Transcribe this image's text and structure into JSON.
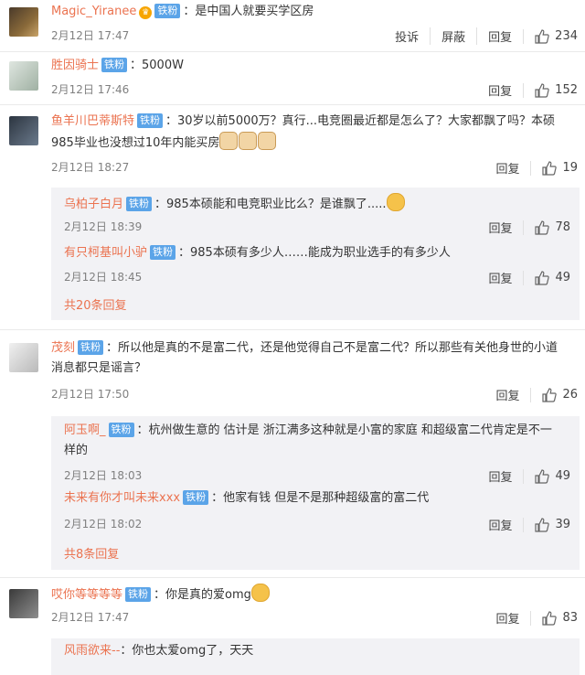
{
  "badge_label": "铁粉",
  "reply_label": "回复",
  "comments": [
    {
      "user": "Magic_Yiranee",
      "text": "：是中国人就要买学区房",
      "time": "2月12日 17:47",
      "complain": "投诉",
      "block": "屏蔽",
      "likes": "234"
    },
    {
      "user": "胜因骑士",
      "text": "：5000W",
      "time": "2月12日 17:46",
      "likes": "152"
    },
    {
      "user": "鱼羊川巴蒂斯特",
      "text": "：30岁以前5000万？真行...电竞圈最近都是怎么了？大家都飘了吗？本硕",
      "text2": "985毕业也没想过10年内能买房",
      "time": "2月12日 18:27",
      "likes": "19",
      "replies": [
        {
          "user": "乌柏子白月",
          "text": "：985本硕能和电竞职业比么？是谁飘了.....",
          "time": "2月12日 18:39",
          "likes": "78"
        },
        {
          "user": "有只柯基叫小驴",
          "text": "：985本硕有多少人……能成为职业选手的有多少人",
          "time": "2月12日 18:45",
          "likes": "49"
        }
      ],
      "more": "共20条回复"
    },
    {
      "user": "茂刻",
      "text": "：所以他是真的不是富二代，还是他觉得自己不是富二代？所以那些有关他身世的小道",
      "text2": "消息都只是谣言？",
      "time": "2月12日 17:50",
      "likes": "26",
      "replies": [
        {
          "user": "阿玉啊_",
          "text": "：杭州做生意的 估计是 浙江满多这种就是小富的家庭 和超级富二代肯定是不一",
          "text2": "样的",
          "time": "2月12日 18:03",
          "likes": "49"
        },
        {
          "user": "未来有你才叫未来xxx",
          "text": "：他家有钱 但是不是那种超级富的富二代",
          "time": "2月12日 18:02",
          "likes": "39"
        }
      ],
      "more": "共8条回复"
    },
    {
      "user": "哎你等等等等",
      "text": "：你是真的爱omg",
      "time": "2月12日 17:47",
      "likes": "83",
      "replies": [
        {
          "user": "风雨欲来--",
          "text": "：你也太爱omg了，天天"
        }
      ]
    }
  ]
}
